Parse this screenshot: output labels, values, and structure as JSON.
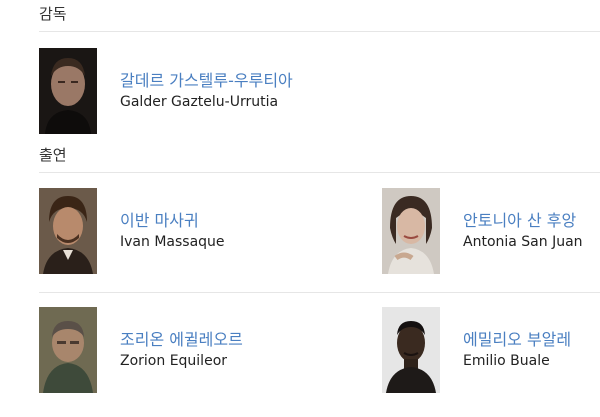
{
  "sections": {
    "director": {
      "title": "감독",
      "people": [
        {
          "name_ko": "갈데르 가스텔루-우루티아",
          "name_en": "Galder Gaztelu-Urrutia",
          "photo": "director-portrait"
        }
      ]
    },
    "cast": {
      "title": "출연",
      "people": [
        {
          "name_ko": "이반 마사귀",
          "name_en": "Ivan Massaque",
          "photo": "actor-portrait"
        },
        {
          "name_ko": "안토니아 산 후앙",
          "name_en": "Antonia San Juan",
          "photo": "actress-portrait"
        },
        {
          "name_ko": "조리온 에귈레오르",
          "name_en": "Zorion Equileor",
          "photo": "actor-portrait"
        },
        {
          "name_ko": "에밀리오 부알레",
          "name_en": "Emilio Buale",
          "photo": "actor-portrait"
        }
      ]
    }
  }
}
